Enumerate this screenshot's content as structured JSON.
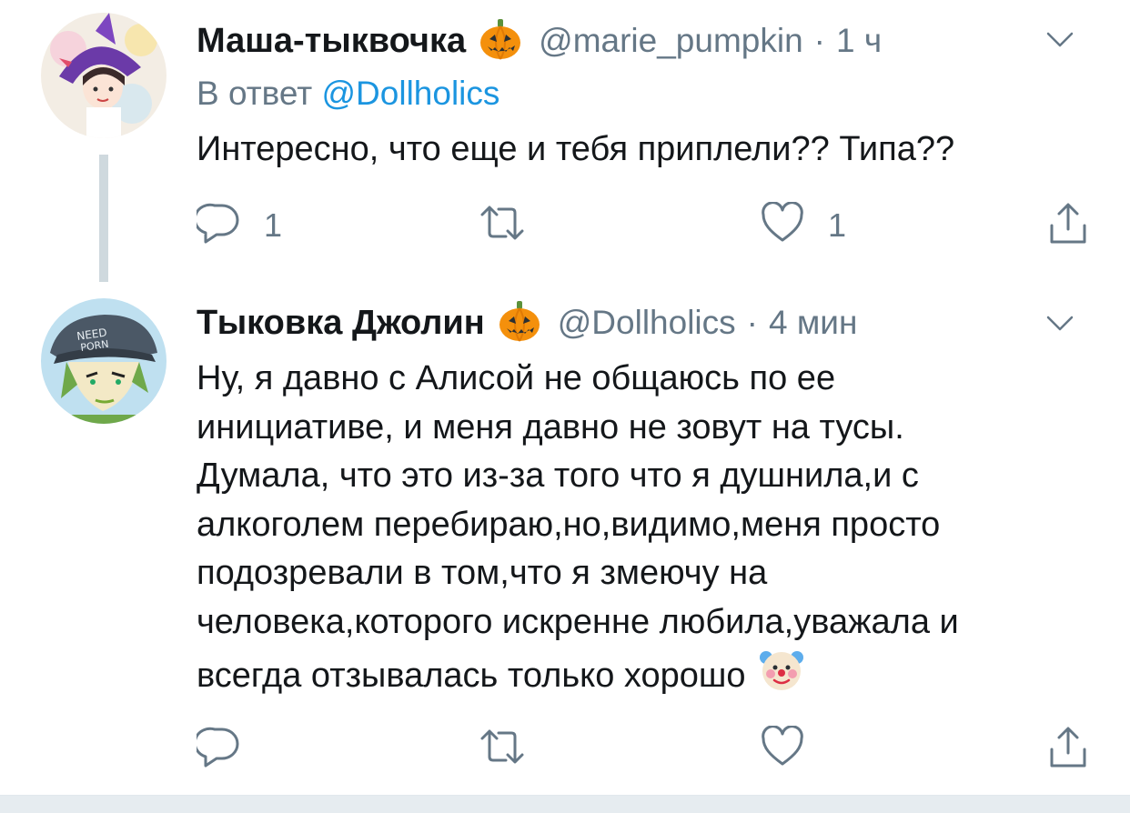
{
  "tweets": [
    {
      "display_name": "Маша-тыквочка",
      "name_emoji": "pumpkin-emoji",
      "handle": "@marie_pumpkin",
      "dot": "·",
      "time": "1 ч",
      "reply_prefix": "В ответ",
      "reply_mention": "@Dollholics",
      "text": "Интересно, что еще и тебя приплели?? Типа??",
      "reply_count": "1",
      "retweet_count": "",
      "like_count": "1"
    },
    {
      "display_name": "Тыковка Джолин",
      "name_emoji": "pumpkin-emoji",
      "handle": "@Dollholics",
      "dot": "·",
      "time": "4 мин",
      "text_lines": [
        "Ну, я давно с Алисой не общаюсь по ее",
        "инициативе, и меня давно не зовут на тусы.",
        "Думала, что это из-за того что я душнила,и с",
        "алкоголем перебираю,но,видимо,меня просто",
        "подозревали в том,что я змеючу на",
        "человека,которого искренне любила,уважала и",
        "всегда отзывалась только хорошо"
      ],
      "end_emoji": "clown-face-emoji",
      "reply_count": "",
      "retweet_count": "",
      "like_count": ""
    }
  ],
  "icons": {
    "reply": "reply-icon",
    "retweet": "retweet-icon",
    "like": "like-icon",
    "share": "share-icon",
    "menu": "chevron-down-icon"
  },
  "colors": {
    "text": "#14171a",
    "secondary": "#657786",
    "link": "#1b95e0",
    "thread_line": "#cfd9de",
    "pumpkin": "#f4900c"
  }
}
